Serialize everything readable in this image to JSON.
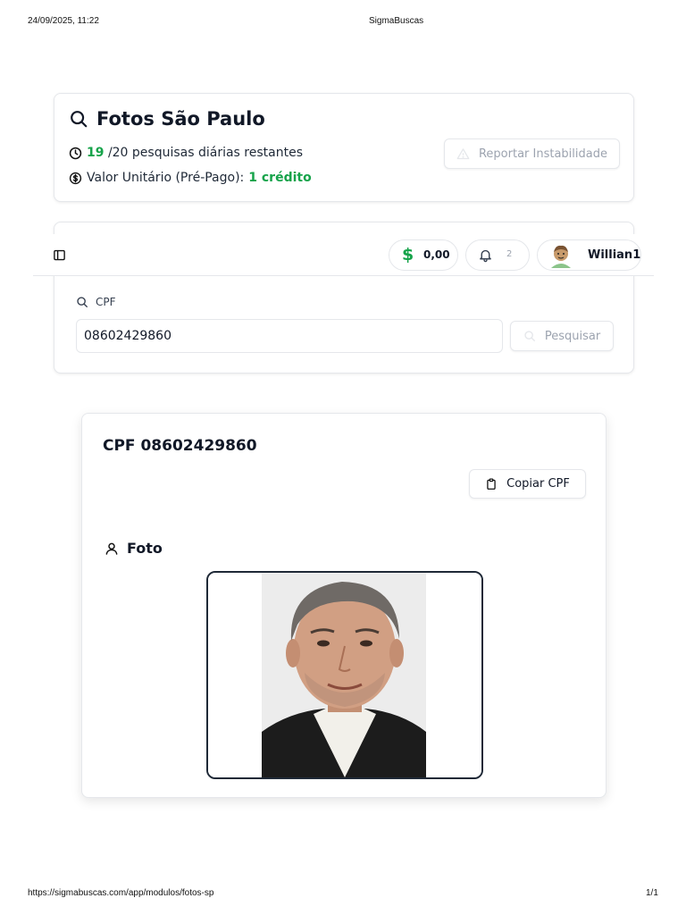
{
  "print_header": {
    "datetime": "24/09/2025, 11:22",
    "title": "SigmaBuscas"
  },
  "print_footer": {
    "url": "https://sigmabuscas.com/app/modulos/fotos-sp",
    "page": "1/1"
  },
  "module": {
    "title": "Fotos São Paulo",
    "searches_remaining": "19",
    "searches_suffix": "/20 pesquisas diárias restantes",
    "unit_value_label": "Valor Unitário (Pré-Pago):",
    "unit_value": "1 crédito",
    "report_button": "Reportar Instabilidade"
  },
  "topbar": {
    "balance": "0,00",
    "notifications_count": "2",
    "username": "Willian1"
  },
  "search": {
    "field_label": "CPF",
    "input_value": "08602429860",
    "submit_label": "Pesquisar"
  },
  "result": {
    "title": "CPF 08602429860",
    "copy_button": "Copiar CPF",
    "photo_section": "Foto"
  },
  "colors": {
    "accent_green": "#16a34a",
    "border": "#e5e7eb"
  }
}
